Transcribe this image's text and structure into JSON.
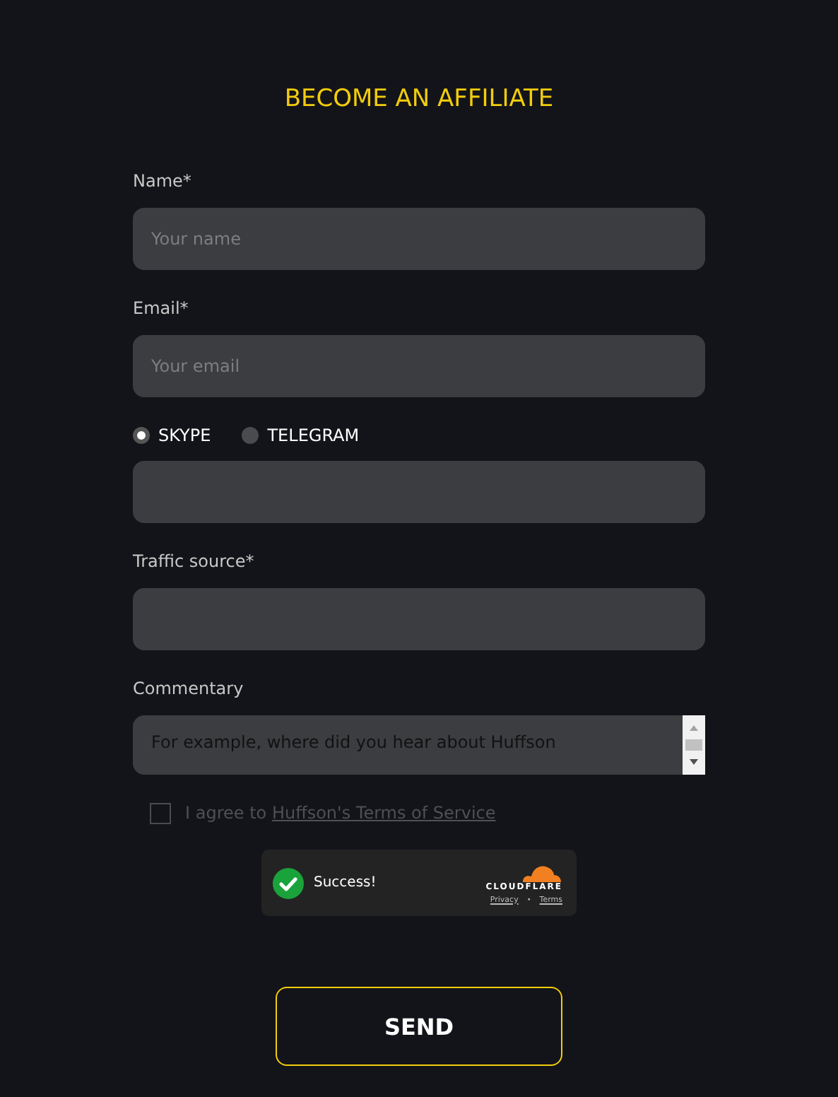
{
  "title": "BECOME AN AFFILIATE",
  "fields": [
    {
      "kind": "input",
      "label": "Name*",
      "placeholder": "Your name"
    },
    {
      "kind": "input",
      "label": "Email*",
      "placeholder": "Your email"
    },
    {
      "kind": "radio-input",
      "options": [
        {
          "label": "SKYPE",
          "selected": true
        },
        {
          "label": "TELEGRAM",
          "selected": false
        }
      ]
    },
    {
      "kind": "input",
      "label": "Traffic source*"
    },
    {
      "kind": "textarea",
      "label": "Commentary",
      "placeholder": "For example, where did you hear about Huffson"
    }
  ],
  "agreement": {
    "text": "I agree to",
    "link": "Huffson's Terms of Service",
    "checked": false
  },
  "captcha": {
    "status": "Success!",
    "brand": "CLOUDFLARE",
    "links": [
      "Privacy",
      "Terms"
    ],
    "separator": "•"
  },
  "submit": "SEND"
}
